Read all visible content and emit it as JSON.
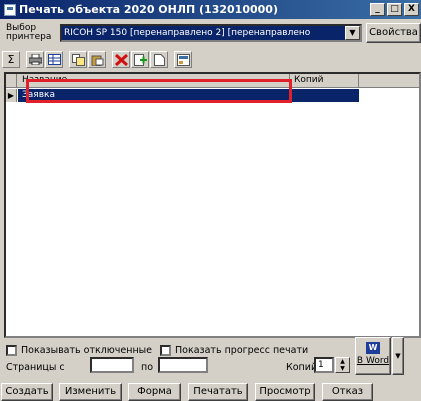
{
  "window": {
    "title": "Печать объекта 2020 ОНЛП (132010000)",
    "minimize": "_",
    "maximize": "□",
    "close": "X"
  },
  "printer": {
    "label": "Выбор принтера",
    "selected": "RICOH SP 150 [перенаправлено 2] [перенаправлено",
    "properties_label": "Свойства"
  },
  "toolbar": {
    "icons": [
      "sum-icon",
      "printer-icon",
      "grid-icon",
      "copy-icon",
      "paste-icon",
      "delete-icon",
      "add-icon",
      "document-icon",
      "settings-icon"
    ],
    "sum_glyph": "Σ"
  },
  "grid": {
    "columns": [
      "Название",
      "Копий"
    ],
    "rows": [
      {
        "name": "Заявка",
        "copies": ""
      }
    ],
    "row_marker": "▶"
  },
  "options": {
    "show_disabled": "Показывать отключенные",
    "show_progress": "Показать прогресс печати",
    "pages_from": "Страницы с",
    "pages_to": "по",
    "copies_label": "Копий:",
    "copies_value": "1",
    "word_label": "В Word"
  },
  "actions": {
    "create": "Создать",
    "edit": "Изменить",
    "form": "Форма",
    "print": "Печатать",
    "preview": "Просмотр",
    "cancel": "Отказ"
  },
  "colors": {
    "selection": "#0a246a",
    "highlight_box": "#e0202a",
    "face": "#d4d0c8"
  }
}
